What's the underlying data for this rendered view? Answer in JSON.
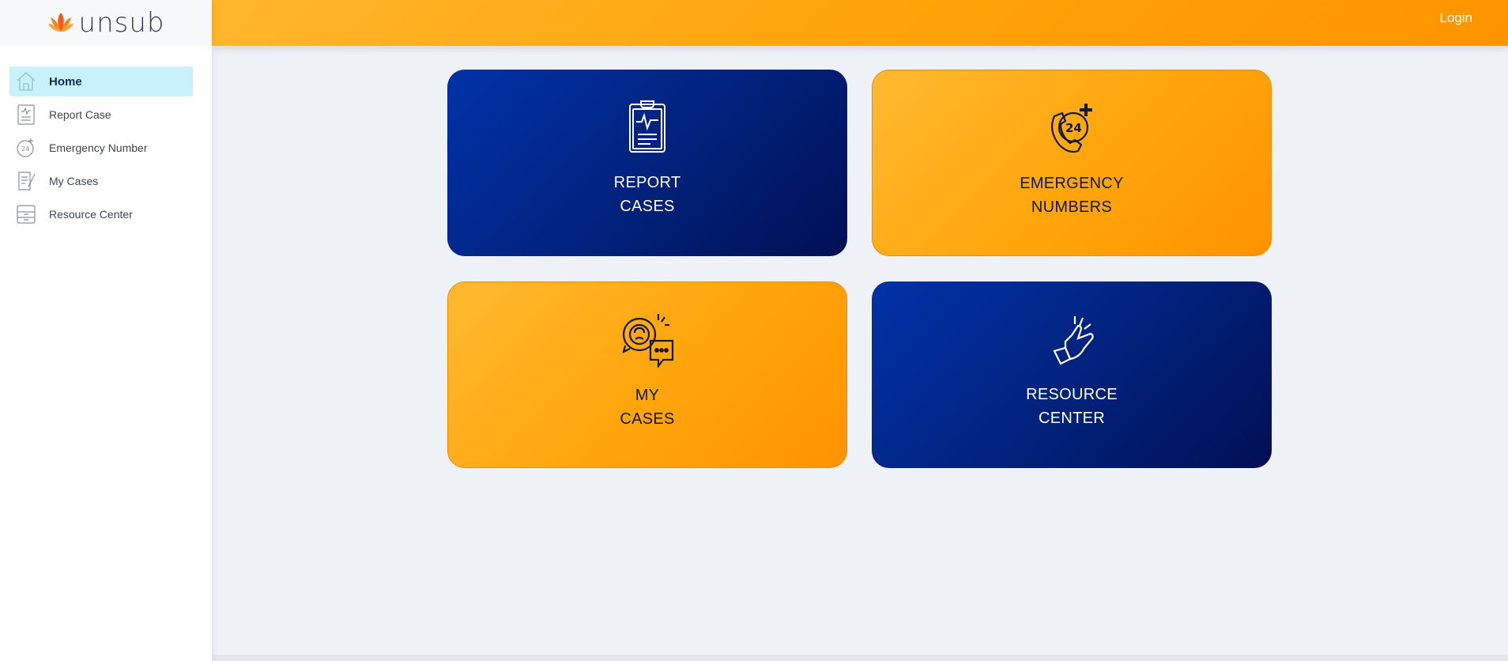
{
  "brand": {
    "logo_text": "unsub"
  },
  "header": {
    "login_label": "Login"
  },
  "sidebar": {
    "items": [
      {
        "label": "Home",
        "icon": "home-icon",
        "active": true
      },
      {
        "label": "Report Case",
        "icon": "clipboard-icon",
        "active": false
      },
      {
        "label": "Emergency Number",
        "icon": "phone-24-icon",
        "active": false
      },
      {
        "label": "My Cases",
        "icon": "notes-icon",
        "active": false
      },
      {
        "label": "Resource Center",
        "icon": "cabinet-icon",
        "active": false
      }
    ]
  },
  "cards": [
    {
      "line1": "REPORT",
      "line2": "CASES",
      "icon": "clipboard-heartbeat-icon",
      "theme": "blue"
    },
    {
      "line1": "EMERGENCY",
      "line2": "NUMBERS",
      "icon": "phone-24-icon",
      "theme": "orange"
    },
    {
      "line1": "MY",
      "line2": "CASES",
      "icon": "chat-bubbles-icon",
      "theme": "orange"
    },
    {
      "line1": "RESOURCE",
      "line2": "CENTER",
      "icon": "hand-pointing-icon",
      "theme": "blue"
    }
  ],
  "colors": {
    "accent_orange": "#ffa40a",
    "accent_blue": "#01217a",
    "active_nav_bg": "#c8f1fb"
  }
}
